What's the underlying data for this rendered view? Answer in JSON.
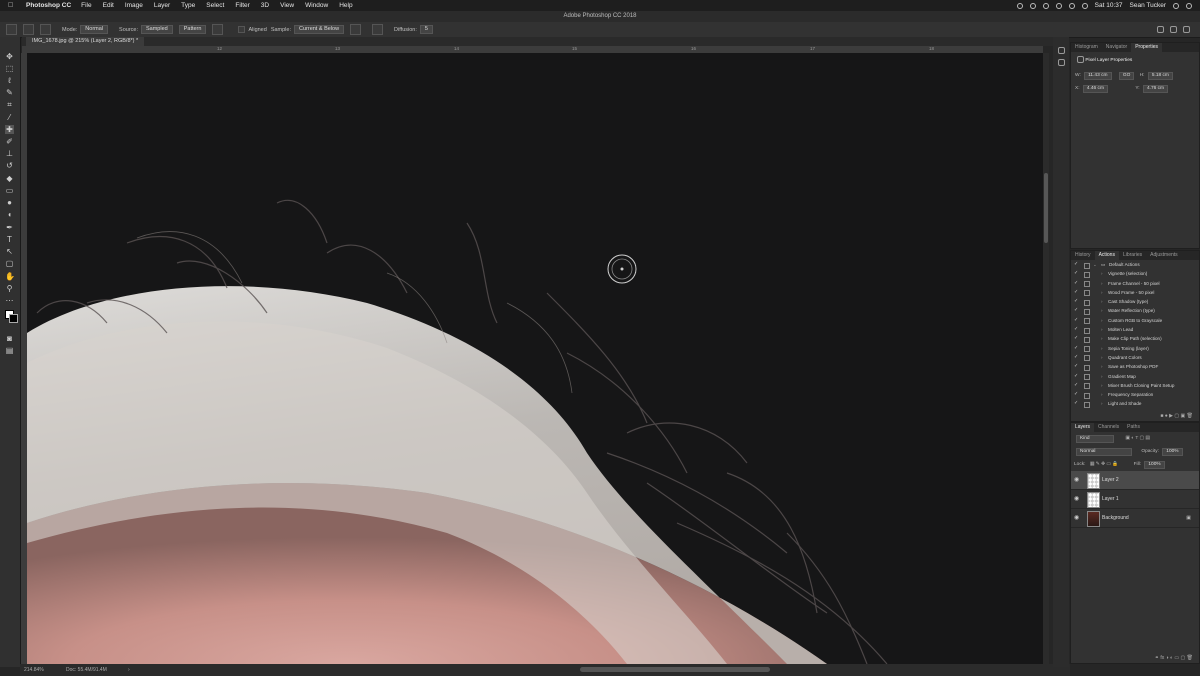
{
  "menubar": {
    "app": "Photoshop CC",
    "menus": [
      "File",
      "Edit",
      "Image",
      "Layer",
      "Type",
      "Select",
      "Filter",
      "3D",
      "View",
      "Window",
      "Help"
    ],
    "clock": "Sat 10:37",
    "user": "Sean Tucker"
  },
  "window": {
    "title": "Adobe Photoshop CC 2018"
  },
  "options": {
    "mode_label": "Mode:",
    "mode_value": "Normal",
    "source_label": "Source:",
    "source_sampled": "Sampled",
    "source_pattern": "Pattern",
    "aligned_label": "Aligned",
    "sample_label": "Sample:",
    "sample_value": "Current & Below",
    "diffusion_label": "Diffusion:",
    "diffusion_value": "5"
  },
  "document": {
    "tab_title": "IMG_1678.jpg @ 215% (Layer 2, RGB/8*) *",
    "ruler_numbers": [
      "12",
      "13",
      "14",
      "15",
      "16",
      "17",
      "18"
    ]
  },
  "status": {
    "zoom": "214.84%",
    "doc_size": "Doc: 55.4M/91.4M"
  },
  "properties_panel": {
    "tabs": [
      "Histogram",
      "Navigator",
      "Properties"
    ],
    "active_tab": "Properties",
    "header": "Pixel Layer Properties",
    "w_label": "W:",
    "w_value": "11.43 cm",
    "h_label": "H:",
    "h_value": "5.18 cm",
    "x_label": "X:",
    "x_value": "4.46 cm",
    "y_label": "Y:",
    "y_value": "4.76 cm",
    "link_label": "GO"
  },
  "actions_panel": {
    "tabs": [
      "History",
      "Actions",
      "Libraries",
      "Adjustments"
    ],
    "active_tab": "Actions",
    "set_name": "Default Actions",
    "items": [
      "Vignette (selection)",
      "Frame Channel - 50 pixel",
      "Wood Frame - 50 pixel",
      "Cast Shadow (type)",
      "Water Reflection (type)",
      "Custom RGB to Grayscale",
      "Molten Lead",
      "Make Clip Path (selection)",
      "Sepia Toning (layer)",
      "Quadrant Colors",
      "Save as Photoshop PDF",
      "Gradient Map",
      "Mixer Brush Cloning Paint Setup",
      "Frequency Separation",
      "Light and Shade"
    ]
  },
  "layers_panel": {
    "tabs": [
      "Layers",
      "Channels",
      "Paths"
    ],
    "active_tab": "Layers",
    "filter_label": "Kind",
    "blend_mode": "Normal",
    "opacity_label": "Opacity:",
    "opacity_value": "100%",
    "lock_label": "Lock:",
    "fill_label": "Fill:",
    "fill_value": "100%",
    "layers": [
      "Layer 2",
      "Layer 1",
      "Background"
    ],
    "selected": "Layer 2"
  },
  "colors": {
    "canvas_bg": "#161617",
    "panel_bg": "#323232",
    "selection": "#4a4a4a"
  }
}
